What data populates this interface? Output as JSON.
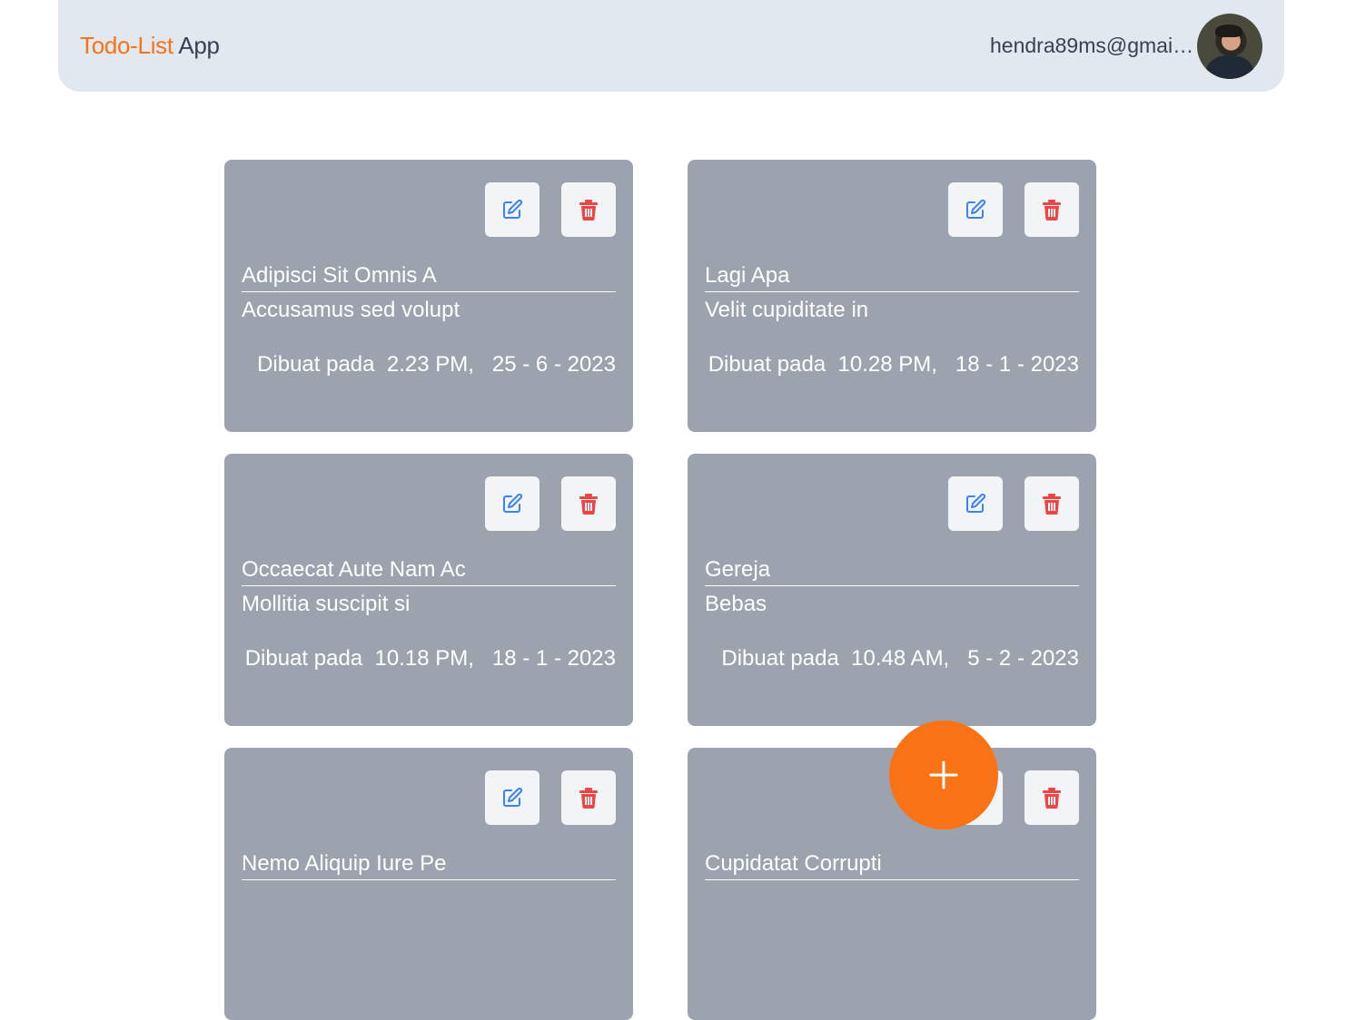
{
  "header": {
    "brand_accent": "Todo-List",
    "brand_rest": "App",
    "user_email": "hendra89ms@gmail.com",
    "avatar_icon": "user-avatar"
  },
  "labels": {
    "created_prefix": "Dibuat pada"
  },
  "colors": {
    "accent": "#f97316",
    "header_bg": "#e2e8f0",
    "card_bg": "#9ca3af",
    "edit_icon": "#3b82f6",
    "delete_icon": "#ef4444"
  },
  "todos": [
    {
      "title": "Adipisci Sit Omnis A",
      "description": "Accusamus sed volupt",
      "time": "2.23 PM,",
      "date": "25 - 6 - 2023"
    },
    {
      "title": "Lagi Apa",
      "description": "Velit cupiditate in",
      "time": "10.28 PM,",
      "date": "18 - 1 - 2023"
    },
    {
      "title": "Occaecat Aute Nam Ac",
      "description": "Mollitia suscipit si",
      "time": "10.18 PM,",
      "date": "18 - 1 - 2023"
    },
    {
      "title": "Gereja",
      "description": "Bebas",
      "time": "10.48 AM,",
      "date": "5 - 2 - 2023"
    },
    {
      "title": "Nemo Aliquip Iure Pe",
      "description": "",
      "time": "",
      "date": ""
    },
    {
      "title": "Cupidatat Corrupti",
      "description": "",
      "time": "",
      "date": ""
    }
  ],
  "fab": {
    "icon": "plus-icon"
  }
}
